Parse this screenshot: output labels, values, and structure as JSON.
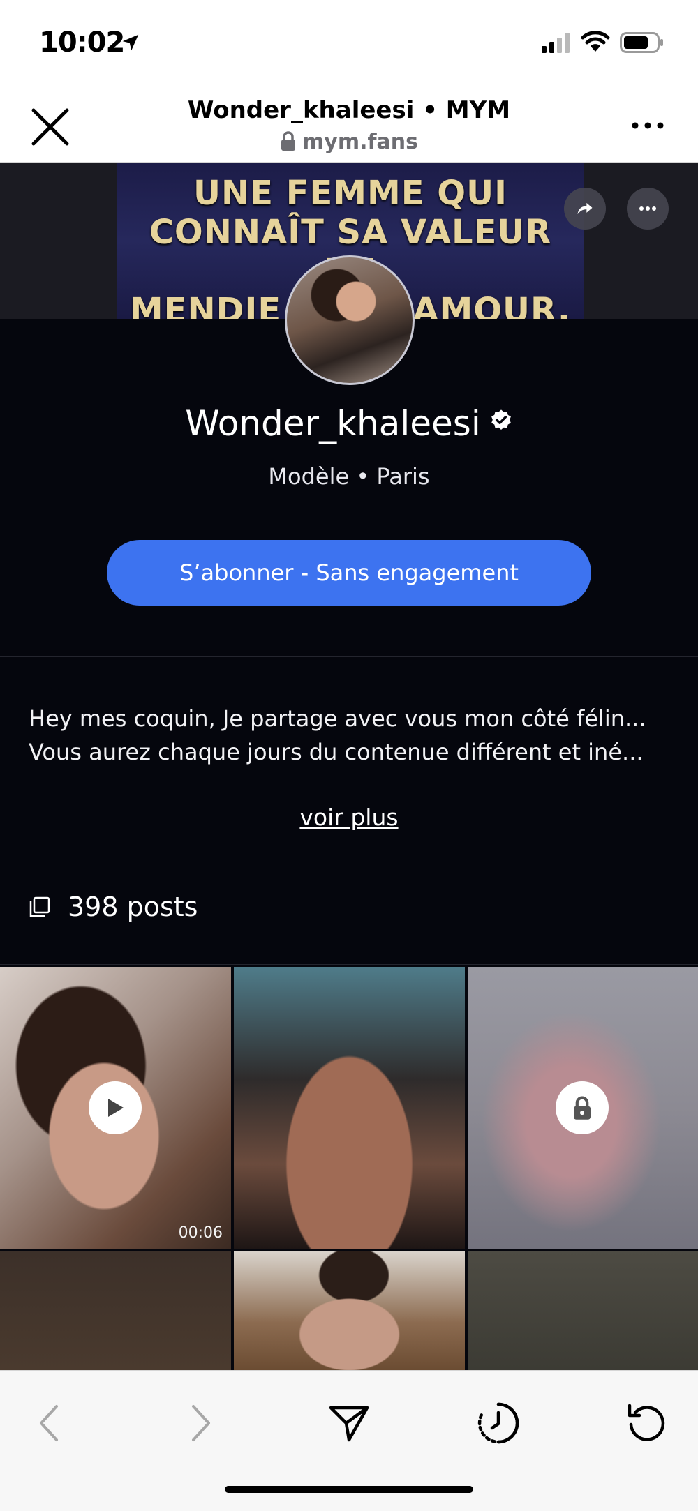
{
  "status_bar": {
    "time": "10:02"
  },
  "browser": {
    "title": "Wonder_khaleesi • MYM",
    "url": "mym.fans"
  },
  "banner": {
    "line1": "UNE FEMME QUI",
    "line2": "CONNAÎT SA VALEUR NE",
    "line3": "MENDIE PAS L'AMOUR."
  },
  "profile": {
    "name": "Wonder_khaleesi",
    "subtitle": "Modèle • Paris",
    "subscribe_label": "S’abonner - Sans engagement",
    "bio_line1": "Hey mes coquin, Je partage avec vous mon côté félin...",
    "bio_line2": "Vous aurez chaque jours du contenue différent et iné...",
    "voir_plus": "voir plus",
    "posts_count": "398 posts"
  },
  "grid": {
    "tile1_duration": "00:06"
  },
  "colors": {
    "background": "#05060d",
    "accent": "#3d73f0"
  }
}
